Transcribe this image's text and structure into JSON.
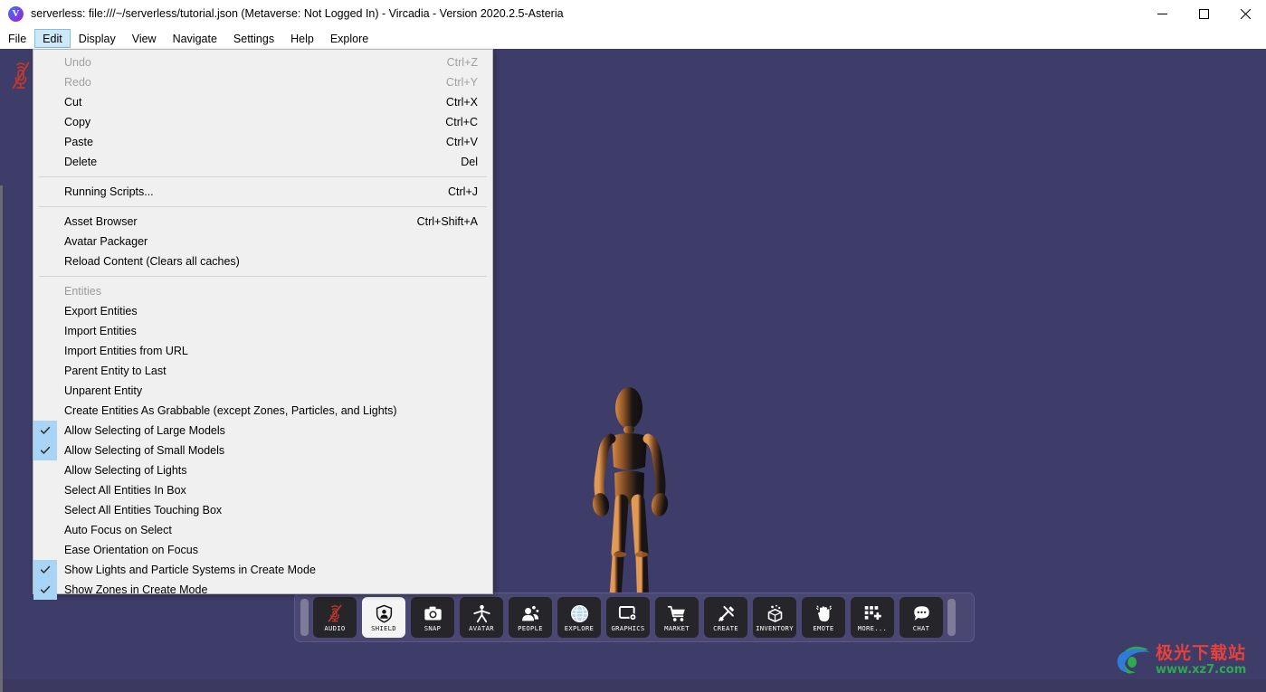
{
  "window": {
    "title": "serverless: file:///~/serverless/tutorial.json (Metaverse: Not Logged In) - Vircadia - Version 2020.2.5-Asteria",
    "logo_letter": "V",
    "controls": {
      "minimize": "minimize-button",
      "maximize": "maximize-button",
      "close": "close-button"
    }
  },
  "menubar": {
    "items": [
      {
        "label": "File",
        "active": false
      },
      {
        "label": "Edit",
        "active": true
      },
      {
        "label": "Display",
        "active": false
      },
      {
        "label": "View",
        "active": false
      },
      {
        "label": "Navigate",
        "active": false
      },
      {
        "label": "Settings",
        "active": false
      },
      {
        "label": "Help",
        "active": false
      },
      {
        "label": "Explore",
        "active": false
      }
    ]
  },
  "edit_menu": {
    "open": true,
    "entries": [
      {
        "type": "item",
        "label": "Undo",
        "shortcut": "Ctrl+Z",
        "disabled": true,
        "checked": false
      },
      {
        "type": "item",
        "label": "Redo",
        "shortcut": "Ctrl+Y",
        "disabled": true,
        "checked": false
      },
      {
        "type": "item",
        "label": "Cut",
        "shortcut": "Ctrl+X",
        "disabled": false,
        "checked": false
      },
      {
        "type": "item",
        "label": "Copy",
        "shortcut": "Ctrl+C",
        "disabled": false,
        "checked": false
      },
      {
        "type": "item",
        "label": "Paste",
        "shortcut": "Ctrl+V",
        "disabled": false,
        "checked": false
      },
      {
        "type": "item",
        "label": "Delete",
        "shortcut": "Del",
        "disabled": false,
        "checked": false
      },
      {
        "type": "separator"
      },
      {
        "type": "item",
        "label": "Running Scripts...",
        "shortcut": "Ctrl+J",
        "disabled": false,
        "checked": false
      },
      {
        "type": "separator"
      },
      {
        "type": "item",
        "label": "Asset Browser",
        "shortcut": "Ctrl+Shift+A",
        "disabled": false,
        "checked": false
      },
      {
        "type": "item",
        "label": "Avatar Packager",
        "shortcut": "",
        "disabled": false,
        "checked": false
      },
      {
        "type": "item",
        "label": "Reload Content (Clears all caches)",
        "shortcut": "",
        "disabled": false,
        "checked": false
      },
      {
        "type": "separator"
      },
      {
        "type": "header",
        "label": "Entities",
        "shortcut": "",
        "disabled": false,
        "checked": false
      },
      {
        "type": "item",
        "label": "Export Entities",
        "shortcut": "",
        "disabled": false,
        "checked": false
      },
      {
        "type": "item",
        "label": "Import Entities",
        "shortcut": "",
        "disabled": false,
        "checked": false
      },
      {
        "type": "item",
        "label": "Import Entities from URL",
        "shortcut": "",
        "disabled": false,
        "checked": false
      },
      {
        "type": "item",
        "label": "Parent Entity to Last",
        "shortcut": "",
        "disabled": false,
        "checked": false
      },
      {
        "type": "item",
        "label": "Unparent Entity",
        "shortcut": "",
        "disabled": false,
        "checked": false
      },
      {
        "type": "item",
        "label": "Create Entities As Grabbable (except Zones, Particles, and Lights)",
        "shortcut": "",
        "disabled": false,
        "checked": false
      },
      {
        "type": "item",
        "label": "Allow Selecting of Large Models",
        "shortcut": "",
        "disabled": false,
        "checked": true
      },
      {
        "type": "item",
        "label": "Allow Selecting of Small Models",
        "shortcut": "",
        "disabled": false,
        "checked": true
      },
      {
        "type": "item",
        "label": "Allow Selecting of Lights",
        "shortcut": "",
        "disabled": false,
        "checked": false
      },
      {
        "type": "item",
        "label": "Select All Entities In Box",
        "shortcut": "",
        "disabled": false,
        "checked": false
      },
      {
        "type": "item",
        "label": "Select All Entities Touching Box",
        "shortcut": "",
        "disabled": false,
        "checked": false
      },
      {
        "type": "item",
        "label": "Auto Focus on Select",
        "shortcut": "",
        "disabled": false,
        "checked": false
      },
      {
        "type": "item",
        "label": "Ease Orientation on Focus",
        "shortcut": "",
        "disabled": false,
        "checked": false
      },
      {
        "type": "item",
        "label": "Show Lights and Particle Systems in Create Mode",
        "shortcut": "",
        "disabled": false,
        "checked": true
      },
      {
        "type": "item",
        "label": "Show Zones in Create Mode",
        "shortcut": "",
        "disabled": false,
        "checked": true
      }
    ]
  },
  "viewport": {
    "background_color": "#3e3c68",
    "mic_icon": "microphone-muted-icon",
    "mic_color": "#c0392b",
    "avatar_name": "wooden-mannequin-avatar"
  },
  "toolbar": {
    "buttons": [
      {
        "label": "AUDIO",
        "icon": "microphone-muted-icon",
        "active": false
      },
      {
        "label": "SHIELD",
        "icon": "shield-person-icon",
        "active": true
      },
      {
        "label": "SNAP",
        "icon": "camera-icon",
        "active": false
      },
      {
        "label": "AVATAR",
        "icon": "person-icon",
        "active": false
      },
      {
        "label": "PEOPLE",
        "icon": "people-group-icon",
        "active": false
      },
      {
        "label": "EXPLORE",
        "icon": "globe-icon",
        "active": false
      },
      {
        "label": "GRAPHICS",
        "icon": "monitor-gear-icon",
        "active": false
      },
      {
        "label": "MARKET",
        "icon": "shopping-cart-icon",
        "active": false
      },
      {
        "label": "CREATE",
        "icon": "hammer-wrench-icon",
        "active": false
      },
      {
        "label": "INVENTORY",
        "icon": "box-sparkle-icon",
        "active": false
      },
      {
        "label": "EMOTE",
        "icon": "waving-hand-icon",
        "active": false
      },
      {
        "label": "MORE...",
        "icon": "grid-plus-icon",
        "active": false
      },
      {
        "label": "CHAT",
        "icon": "chat-bubble-icon",
        "active": false
      }
    ]
  },
  "watermark": {
    "chinese": "极光下载站",
    "url": "www.xz7.com"
  },
  "colors": {
    "viewport_bg": "#3e3c68",
    "toolbar_bg": "#4a4873",
    "menu_bg": "#f0f0f0",
    "check_highlight": "#a8d4f5",
    "menu_active": "#cde8f7"
  }
}
